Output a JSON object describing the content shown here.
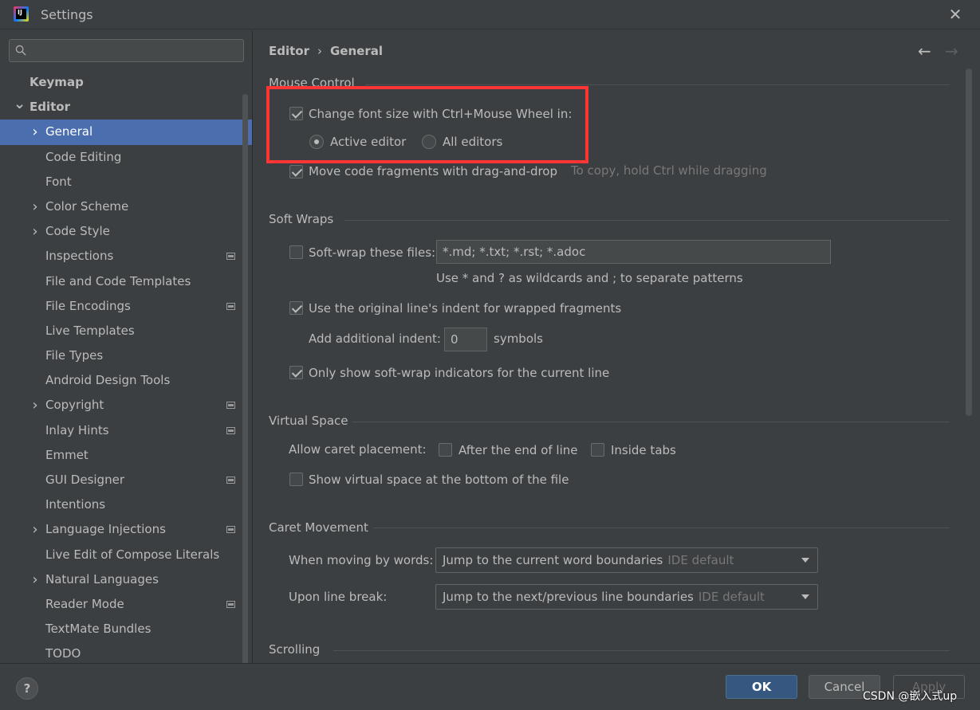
{
  "window": {
    "title": "Settings",
    "logo_text": "IJ"
  },
  "search": {
    "placeholder": ""
  },
  "sidebar": {
    "items": [
      {
        "label": "Keymap",
        "level": 0,
        "arrow": "",
        "bold": true,
        "badge": false,
        "selected": false
      },
      {
        "label": "Editor",
        "level": 0,
        "arrow": "down",
        "bold": true,
        "badge": false,
        "selected": false
      },
      {
        "label": "General",
        "level": 1,
        "arrow": "right",
        "bold": false,
        "badge": false,
        "selected": true
      },
      {
        "label": "Code Editing",
        "level": 1,
        "arrow": "",
        "bold": false,
        "badge": false,
        "selected": false
      },
      {
        "label": "Font",
        "level": 1,
        "arrow": "",
        "bold": false,
        "badge": false,
        "selected": false
      },
      {
        "label": "Color Scheme",
        "level": 1,
        "arrow": "right",
        "bold": false,
        "badge": false,
        "selected": false
      },
      {
        "label": "Code Style",
        "level": 1,
        "arrow": "right",
        "bold": false,
        "badge": false,
        "selected": false
      },
      {
        "label": "Inspections",
        "level": 1,
        "arrow": "",
        "bold": false,
        "badge": true,
        "selected": false
      },
      {
        "label": "File and Code Templates",
        "level": 1,
        "arrow": "",
        "bold": false,
        "badge": false,
        "selected": false
      },
      {
        "label": "File Encodings",
        "level": 1,
        "arrow": "",
        "bold": false,
        "badge": true,
        "selected": false
      },
      {
        "label": "Live Templates",
        "level": 1,
        "arrow": "",
        "bold": false,
        "badge": false,
        "selected": false
      },
      {
        "label": "File Types",
        "level": 1,
        "arrow": "",
        "bold": false,
        "badge": false,
        "selected": false
      },
      {
        "label": "Android Design Tools",
        "level": 1,
        "arrow": "",
        "bold": false,
        "badge": false,
        "selected": false
      },
      {
        "label": "Copyright",
        "level": 1,
        "arrow": "right",
        "bold": false,
        "badge": true,
        "selected": false
      },
      {
        "label": "Inlay Hints",
        "level": 1,
        "arrow": "",
        "bold": false,
        "badge": true,
        "selected": false
      },
      {
        "label": "Emmet",
        "level": 1,
        "arrow": "",
        "bold": false,
        "badge": false,
        "selected": false
      },
      {
        "label": "GUI Designer",
        "level": 1,
        "arrow": "",
        "bold": false,
        "badge": true,
        "selected": false
      },
      {
        "label": "Intentions",
        "level": 1,
        "arrow": "",
        "bold": false,
        "badge": false,
        "selected": false
      },
      {
        "label": "Language Injections",
        "level": 1,
        "arrow": "right",
        "bold": false,
        "badge": true,
        "selected": false
      },
      {
        "label": "Live Edit of Compose Literals",
        "level": 1,
        "arrow": "",
        "bold": false,
        "badge": false,
        "selected": false
      },
      {
        "label": "Natural Languages",
        "level": 1,
        "arrow": "right",
        "bold": false,
        "badge": false,
        "selected": false
      },
      {
        "label": "Reader Mode",
        "level": 1,
        "arrow": "",
        "bold": false,
        "badge": true,
        "selected": false
      },
      {
        "label": "TextMate Bundles",
        "level": 1,
        "arrow": "",
        "bold": false,
        "badge": false,
        "selected": false
      },
      {
        "label": "TODO",
        "level": 1,
        "arrow": "",
        "bold": false,
        "badge": false,
        "selected": false
      }
    ]
  },
  "breadcrumb": {
    "parent": "Editor",
    "separator": "›",
    "current": "General"
  },
  "nav": {
    "back": "←",
    "forward": "→"
  },
  "mouse_control": {
    "title": "Mouse Control",
    "font_size_wheel": {
      "label": "Change font size with Ctrl+Mouse Wheel in:",
      "checked": true
    },
    "active_editor": {
      "label": "Active editor",
      "selected": true
    },
    "all_editors": {
      "label": "All editors",
      "selected": false
    },
    "drag_drop": {
      "label": "Move code fragments with drag-and-drop",
      "hint": "To copy, hold Ctrl while dragging",
      "checked": true
    }
  },
  "soft_wraps": {
    "title": "Soft Wraps",
    "soft_wrap_files": {
      "label": "Soft-wrap these files:",
      "value": "*.md; *.txt; *.rst; *.adoc",
      "checked": false
    },
    "wildcard_hint": "Use * and ? as wildcards and ; to separate patterns",
    "original_indent": {
      "label": "Use the original line's indent for wrapped fragments",
      "checked": true
    },
    "additional_indent": {
      "label": "Add additional indent:",
      "value": "0",
      "unit": "symbols"
    },
    "indicators": {
      "label": "Only show soft-wrap indicators for the current line",
      "checked": true
    }
  },
  "virtual_space": {
    "title": "Virtual Space",
    "caret_label": "Allow caret placement:",
    "after_end": {
      "label": "After the end of line",
      "checked": false
    },
    "inside_tabs": {
      "label": "Inside tabs",
      "checked": false
    },
    "bottom": {
      "label": "Show virtual space at the bottom of the file",
      "checked": false
    }
  },
  "caret_movement": {
    "title": "Caret Movement",
    "words": {
      "label": "When moving by words:",
      "value": "Jump to the current word boundaries",
      "default": "IDE default"
    },
    "line_break": {
      "label": "Upon line break:",
      "value": "Jump to the next/previous line boundaries",
      "default": "IDE default"
    }
  },
  "scrolling": {
    "title": "Scrolling"
  },
  "footer": {
    "help": "?",
    "ok": "OK",
    "cancel": "Cancel",
    "apply": "Apply"
  },
  "watermark": "CSDN @嵌入式up",
  "colors": {
    "accent": "#4b6eaf",
    "highlight": "#ff3434",
    "ok_button": "#365880"
  }
}
